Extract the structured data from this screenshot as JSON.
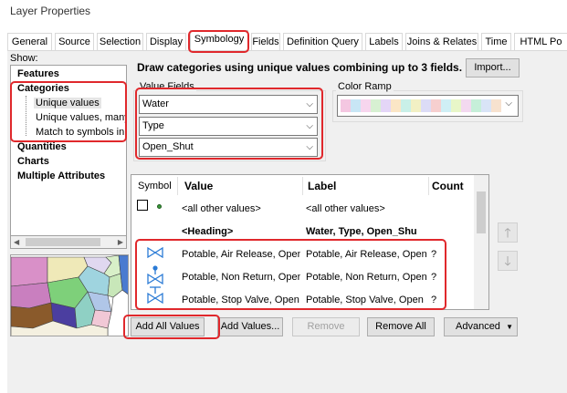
{
  "window": {
    "title": "Layer Properties"
  },
  "tabs": [
    {
      "label": "General"
    },
    {
      "label": "Source"
    },
    {
      "label": "Selection"
    },
    {
      "label": "Display"
    },
    {
      "label": "Symbology"
    },
    {
      "label": "Fields"
    },
    {
      "label": "Definition Query"
    },
    {
      "label": "Labels"
    },
    {
      "label": "Joins & Relates"
    },
    {
      "label": "Time"
    },
    {
      "label": "HTML Po"
    }
  ],
  "active_tab": "Symbology",
  "show": {
    "label": "Show:",
    "items": [
      {
        "label": "Features"
      },
      {
        "label": "Categories"
      },
      {
        "label": "Unique values"
      },
      {
        "label": "Unique values, many"
      },
      {
        "label": "Match to symbols in a"
      },
      {
        "label": "Quantities"
      },
      {
        "label": "Charts"
      },
      {
        "label": "Multiple Attributes"
      }
    ],
    "selected": "Unique values"
  },
  "description": "Draw categories using unique values combining up to 3 fields.",
  "import_button": "Import...",
  "value_fields": {
    "label": "Value Fields",
    "fields": [
      "Water",
      "Type",
      "Open_Shut"
    ]
  },
  "color_ramp": {
    "label": "Color Ramp",
    "colors": [
      "#f4c7e1",
      "#c8e6f5",
      "#f7d6ee",
      "#d7f0d2",
      "#e4d6f7",
      "#fbe6c6",
      "#c9f0e8",
      "#f2f0c4",
      "#dcdcf6",
      "#f6cfcf",
      "#cfeff5",
      "#e8f6c8",
      "#f3d9f0",
      "#c6efd9",
      "#d9e4f7",
      "#f7e2cf"
    ]
  },
  "table": {
    "headers": {
      "symbol": "Symbol",
      "value": "Value",
      "label": "Label",
      "count": "Count"
    },
    "rows": [
      {
        "value": "<all other values>",
        "label": "<all other values>",
        "count": ""
      },
      {
        "value": "<Heading>",
        "label": "Water, Type, Open_Shu",
        "count": ""
      },
      {
        "value": "Potable, Air Release, Open",
        "label": "Potable, Air Release, Open",
        "count": "?"
      },
      {
        "value": "Potable, Non Return, Open",
        "label": "Potable, Non Return, Open",
        "count": "?"
      },
      {
        "value": "Potable, Stop Valve, Open",
        "label": "Potable, Stop Valve, Open",
        "count": "?"
      }
    ]
  },
  "buttons": {
    "add_all": "Add All Values",
    "add": "Add Values...",
    "remove": "Remove",
    "remove_all": "Remove All",
    "advanced": "Advanced"
  },
  "colors": {
    "highlight": "#e0282c",
    "symbol_blue": "#2b7bd6",
    "point_green": "#3a9a3a"
  }
}
